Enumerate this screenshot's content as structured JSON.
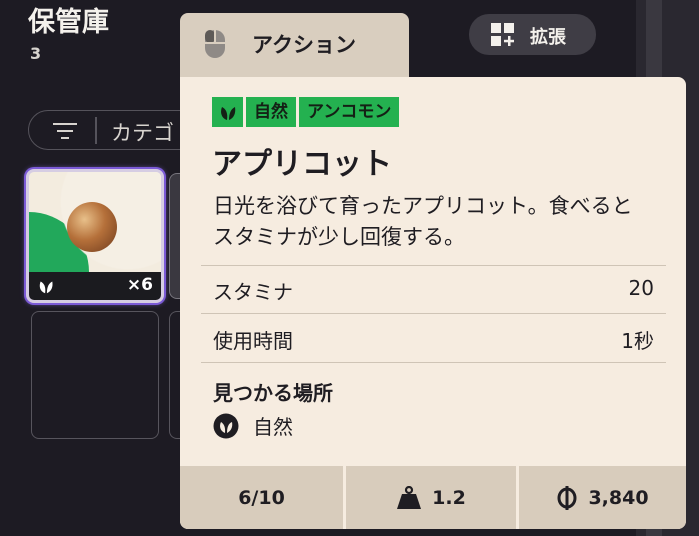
{
  "storage": {
    "title": "保管庫",
    "count": "3"
  },
  "filter": {
    "label": "カテゴ"
  },
  "slot": {
    "quantity": "×6"
  },
  "tabs": {
    "action_label": "アクション"
  },
  "expand": {
    "label": "拡張"
  },
  "item": {
    "tag_category": "自然",
    "tag_rarity": "アンコモン",
    "name": "アプリコット",
    "description": "日光を浴びて育ったアプリコット。食べるとスタミナが少し回復する。",
    "stats": [
      {
        "label": "スタミナ",
        "value": "20"
      },
      {
        "label": "使用時間",
        "value": "1秒"
      }
    ],
    "found_title": "見つかる場所",
    "found_location": "自然"
  },
  "footer": {
    "stack": "6/10",
    "weight": "1.2",
    "price": "3,840"
  },
  "colors": {
    "tag_green": "#24b150",
    "card_bg": "#f6ece0",
    "footer_bg": "#d8ccbc",
    "selection_purple": "#7b5ad6"
  }
}
